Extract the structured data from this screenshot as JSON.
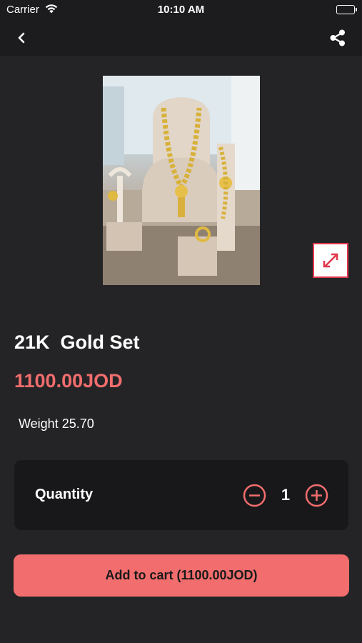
{
  "status_bar": {
    "carrier": "Carrier",
    "time": "10:10 AM"
  },
  "nav": {
    "back_icon": "chevron-left-icon",
    "share_icon": "share-icon"
  },
  "product": {
    "image_subject": "gold necklace, earrings and bracelet on display stand",
    "expand_icon": "expand-arrows-icon",
    "title": "21K  Gold Set",
    "price": "1100.00JOD",
    "weight": "Weight 25.70"
  },
  "quantity": {
    "label": "Quantity",
    "value": "1",
    "minus_icon": "minus-circle-icon",
    "plus_icon": "plus-circle-icon"
  },
  "cart": {
    "button_label": "Add to cart (1100.00JOD)"
  },
  "colors": {
    "background": "#242427",
    "bar": "#1c1c1e",
    "accent": "#f26d6d",
    "card": "#18181a"
  }
}
